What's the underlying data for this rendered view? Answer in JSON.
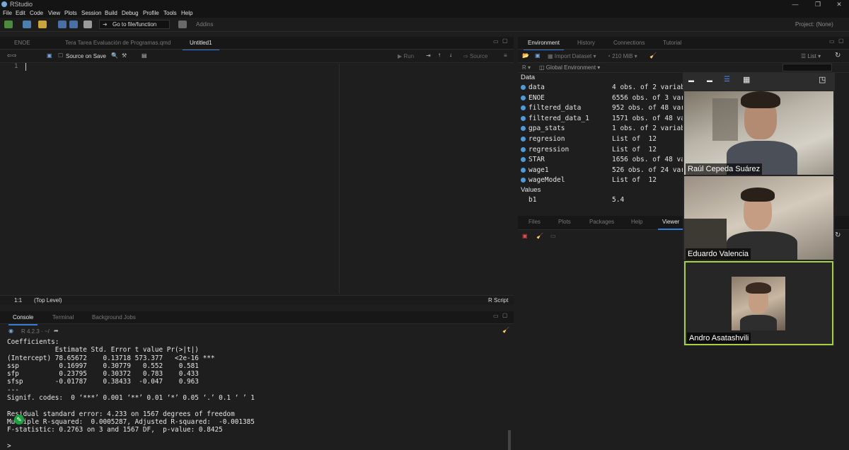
{
  "window": {
    "title": "RStudio",
    "controls": [
      "—",
      "❐",
      "✕"
    ]
  },
  "menu": [
    "File",
    "Edit",
    "Code",
    "View",
    "Plots",
    "Session",
    "Build",
    "Debug",
    "Profile",
    "Tools",
    "Help"
  ],
  "toolbar": {
    "goto_label": "Go to file/function",
    "addins_label": "Addins",
    "project_label": "Project: (None)"
  },
  "editor": {
    "tabs": [
      {
        "label": "ENOE",
        "active": false
      },
      {
        "label": "Tera Tarea Evaluación de Programas.qmd",
        "active": false
      },
      {
        "label": "Untitled1",
        "active": true
      }
    ],
    "source_on_save": "Source on Save",
    "run_label": "Run",
    "source_label": "Source",
    "line_number": "1",
    "status_position": "1:1",
    "status_scope": "(Top Level)",
    "status_filetype": "R Script"
  },
  "console": {
    "tabs": [
      {
        "label": "Console",
        "active": true
      },
      {
        "label": "Terminal",
        "active": false
      },
      {
        "label": "Background Jobs",
        "active": false
      }
    ],
    "r_version": "R 4.2.3 · ~/",
    "lines": [
      "Coefficients:",
      "            Estimate Std. Error t value Pr(>|t|)    ",
      "(Intercept) 78.65672    0.13718 573.377   <2e-16 ***",
      "ssp          0.16997    0.30779   0.552    0.581    ",
      "sfp          0.23795    0.30372   0.783    0.433    ",
      "sfsp        -0.01787    0.38433  -0.047    0.963    ",
      "---",
      "Signif. codes:  0 ‘***’ 0.001 ‘**’ 0.01 ‘*’ 0.05 ‘.’ 0.1 ‘ ’ 1",
      "",
      "Residual standard error: 4.233 on 1567 degrees of freedom",
      "Multiple R-squared:  0.0005287, Adjusted R-squared:  -0.001385 ",
      "F-statistic: 0.2763 on 3 and 1567 DF,  p-value: 0.8425",
      "",
      ">"
    ]
  },
  "environment": {
    "tabs": [
      {
        "label": "Environment",
        "active": true
      },
      {
        "label": "History",
        "active": false
      },
      {
        "label": "Connections",
        "active": false
      },
      {
        "label": "Tutorial",
        "active": false
      }
    ],
    "import_label": "Import Dataset",
    "memory_label": "210 MiB",
    "list_label": "List",
    "lang_label": "R",
    "scope_label": "Global Environment",
    "data_header": "Data",
    "values_header": "Values",
    "data": [
      {
        "name": "data",
        "desc": "4 obs. of 2 variab"
      },
      {
        "name": "ENOE",
        "desc": "6556 obs. of 3 var"
      },
      {
        "name": "filtered_data",
        "desc": "952 obs. of 48 var"
      },
      {
        "name": "filtered_data_1",
        "desc": "1571 obs. of 48 va"
      },
      {
        "name": "gpa_stats",
        "desc": "1 obs. of 2 variab"
      },
      {
        "name": "regresion",
        "desc": "List of  12"
      },
      {
        "name": "regression",
        "desc": "List of  12"
      },
      {
        "name": "STAR",
        "desc": "1656 obs. of 48 va"
      },
      {
        "name": "wage1",
        "desc": "526 obs. of 24 var"
      },
      {
        "name": "wageModel",
        "desc": "List of  12"
      }
    ],
    "values": [
      {
        "name": "b1",
        "value": "5.4"
      }
    ]
  },
  "files": {
    "tabs": [
      {
        "label": "Files",
        "active": false
      },
      {
        "label": "Plots",
        "active": false
      },
      {
        "label": "Packages",
        "active": false
      },
      {
        "label": "Help",
        "active": false
      },
      {
        "label": "Viewer",
        "active": true
      }
    ]
  },
  "video_call": {
    "participants": [
      {
        "name": "Raúl Cepeda Suárez"
      },
      {
        "name": "Eduardo Valencia"
      },
      {
        "name": "Andro Asatashvili"
      }
    ],
    "active_speaker_color": "#a6d144"
  },
  "colors": {
    "accent": "#3a7bd5",
    "env_dot": "#4f9ad9"
  }
}
